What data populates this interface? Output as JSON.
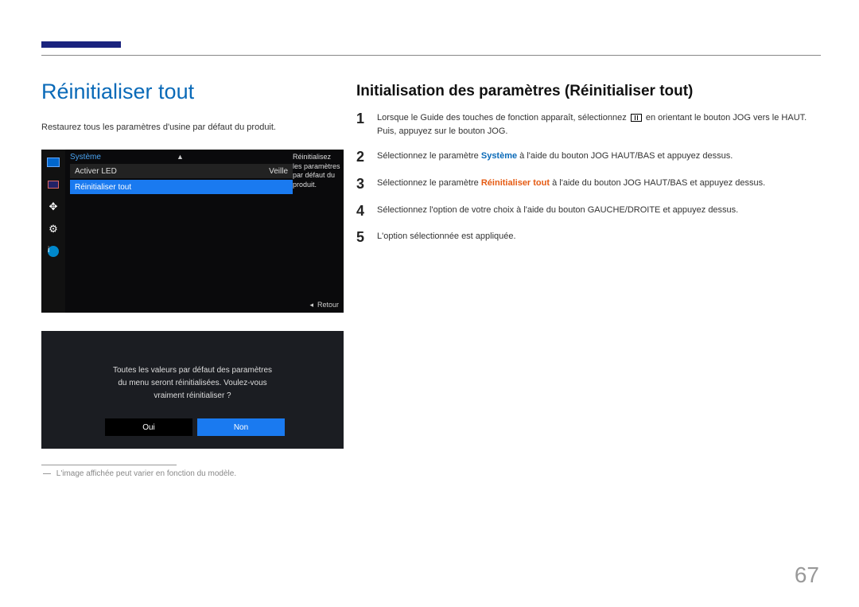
{
  "heading": "Réinitialiser tout",
  "description": "Restaurez tous les paramètres d'usine par défaut du produit.",
  "osd1": {
    "menu_title": "Système",
    "up_arrow": "▲",
    "row1_label": "Activer LED",
    "row1_value": "Veille",
    "row2_label": "Réinitialiser tout",
    "hint": "Réinitialisez les paramètres par défaut du produit.",
    "back_sym": "◂",
    "back_label": "Retour"
  },
  "osd2": {
    "line1": "Toutes les valeurs par défaut des paramètres",
    "line2": "du menu seront réinitialisées. Voulez-vous",
    "line3": "vraiment réinitialiser ?",
    "yes": "Oui",
    "no": "Non"
  },
  "footnote": "L'image affichée peut varier en fonction du modèle.",
  "right_heading": "Initialisation des paramètres (Réinitialiser tout)",
  "steps": {
    "s1": {
      "num": "1",
      "pre": "Lorsque le Guide des touches de fonction apparaît, sélectionnez ",
      "post": " en orientant le bouton JOG vers le HAUT. Puis, appuyez sur le bouton JOG."
    },
    "s2": {
      "num": "2",
      "pre": "Sélectionnez le paramètre ",
      "hl": "Système",
      "post": " à l'aide du bouton JOG HAUT/BAS et appuyez dessus."
    },
    "s3": {
      "num": "3",
      "pre": "Sélectionnez le paramètre ",
      "hl": "Réinitialiser tout",
      "post": " à l'aide du bouton JOG HAUT/BAS et appuyez dessus."
    },
    "s4": {
      "num": "4",
      "text": "Sélectionnez l'option de votre choix à l'aide du bouton GAUCHE/DROITE et appuyez dessus."
    },
    "s5": {
      "num": "5",
      "text": "L'option sélectionnée est appliquée."
    }
  },
  "page_number": "67"
}
